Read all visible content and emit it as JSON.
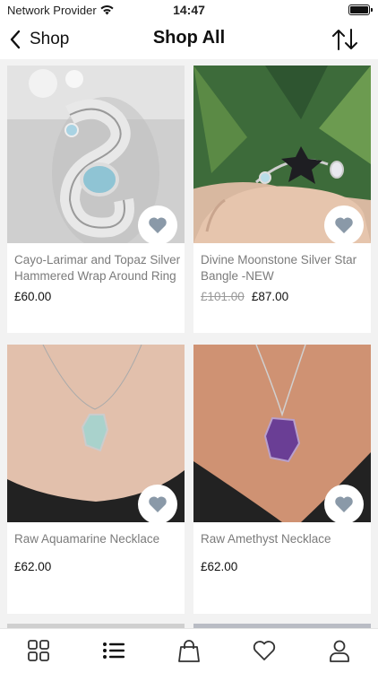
{
  "status": {
    "carrier": "Network Provider",
    "time": "14:47"
  },
  "nav": {
    "back_label": "Shop",
    "title": "Shop All"
  },
  "products": [
    {
      "name": "Cayo-Larimar and Topaz Silver Hammered Wrap Around Ring",
      "price": "£60.00",
      "old_price": ""
    },
    {
      "name": "Divine Moonstone Silver Star Bangle -NEW",
      "price": "£87.00",
      "old_price": "£101.00"
    },
    {
      "name": "Raw Aquamarine Necklace",
      "price": "£62.00",
      "old_price": ""
    },
    {
      "name": "Raw Amethyst Necklace",
      "price": "£62.00",
      "old_price": ""
    }
  ],
  "tabs": [
    "grid-icon",
    "list-icon",
    "bag-icon",
    "heart-icon",
    "profile-icon"
  ],
  "colors": {
    "heart": "#8a99a8",
    "text_muted": "#7b7b7b"
  }
}
